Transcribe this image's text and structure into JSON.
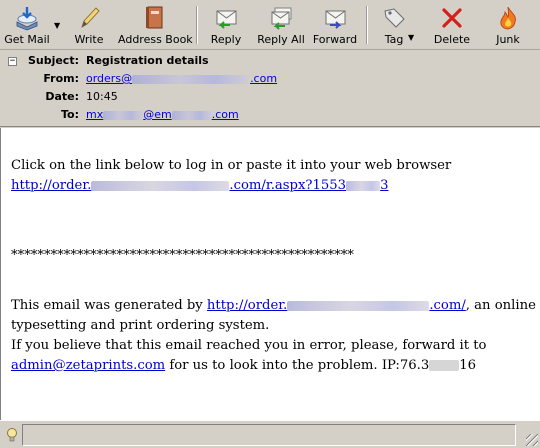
{
  "toolbar": {
    "get_mail": "Get Mail",
    "write": "Write",
    "address_book": "Address Book",
    "reply": "Reply",
    "reply_all": "Reply All",
    "forward": "Forward",
    "tag": "Tag",
    "delete": "Delete",
    "junk": "Junk"
  },
  "header": {
    "subject_label": "Subject:",
    "subject_value": "Registration details",
    "from_label": "From:",
    "from_prefix": "orders@",
    "from_suffix": ".com",
    "date_label": "Date:",
    "date_value": "10:45",
    "to_label": "To:",
    "to_prefix": "mx",
    "to_middle": "@em",
    "to_suffix": ".com"
  },
  "body": {
    "line1": "Click on the link below to log in or paste it into your web browser",
    "link1_prefix": "http://order.",
    "link1_mid": ".com/r.aspx?1553",
    "link1_end": "3",
    "separator": "****************************************************",
    "line_gen_prefix": "This email was generated by ",
    "link2_prefix": "http://order.",
    "link2_suffix": ".com/",
    "line_gen_suffix": ", an online",
    "line_typesetting": "typesetting and print ordering system.",
    "line_error": "If you believe that this email reached you in error, please, forward it to",
    "admin_email": "admin@zetaprints.com",
    "line_look_prefix": " for us to look into the problem. IP:76.3",
    "line_look_suffix": "16"
  },
  "colors": {
    "chrome": "#d4d0c8",
    "link": "#0000cc",
    "body_bg": "#ffffff"
  }
}
